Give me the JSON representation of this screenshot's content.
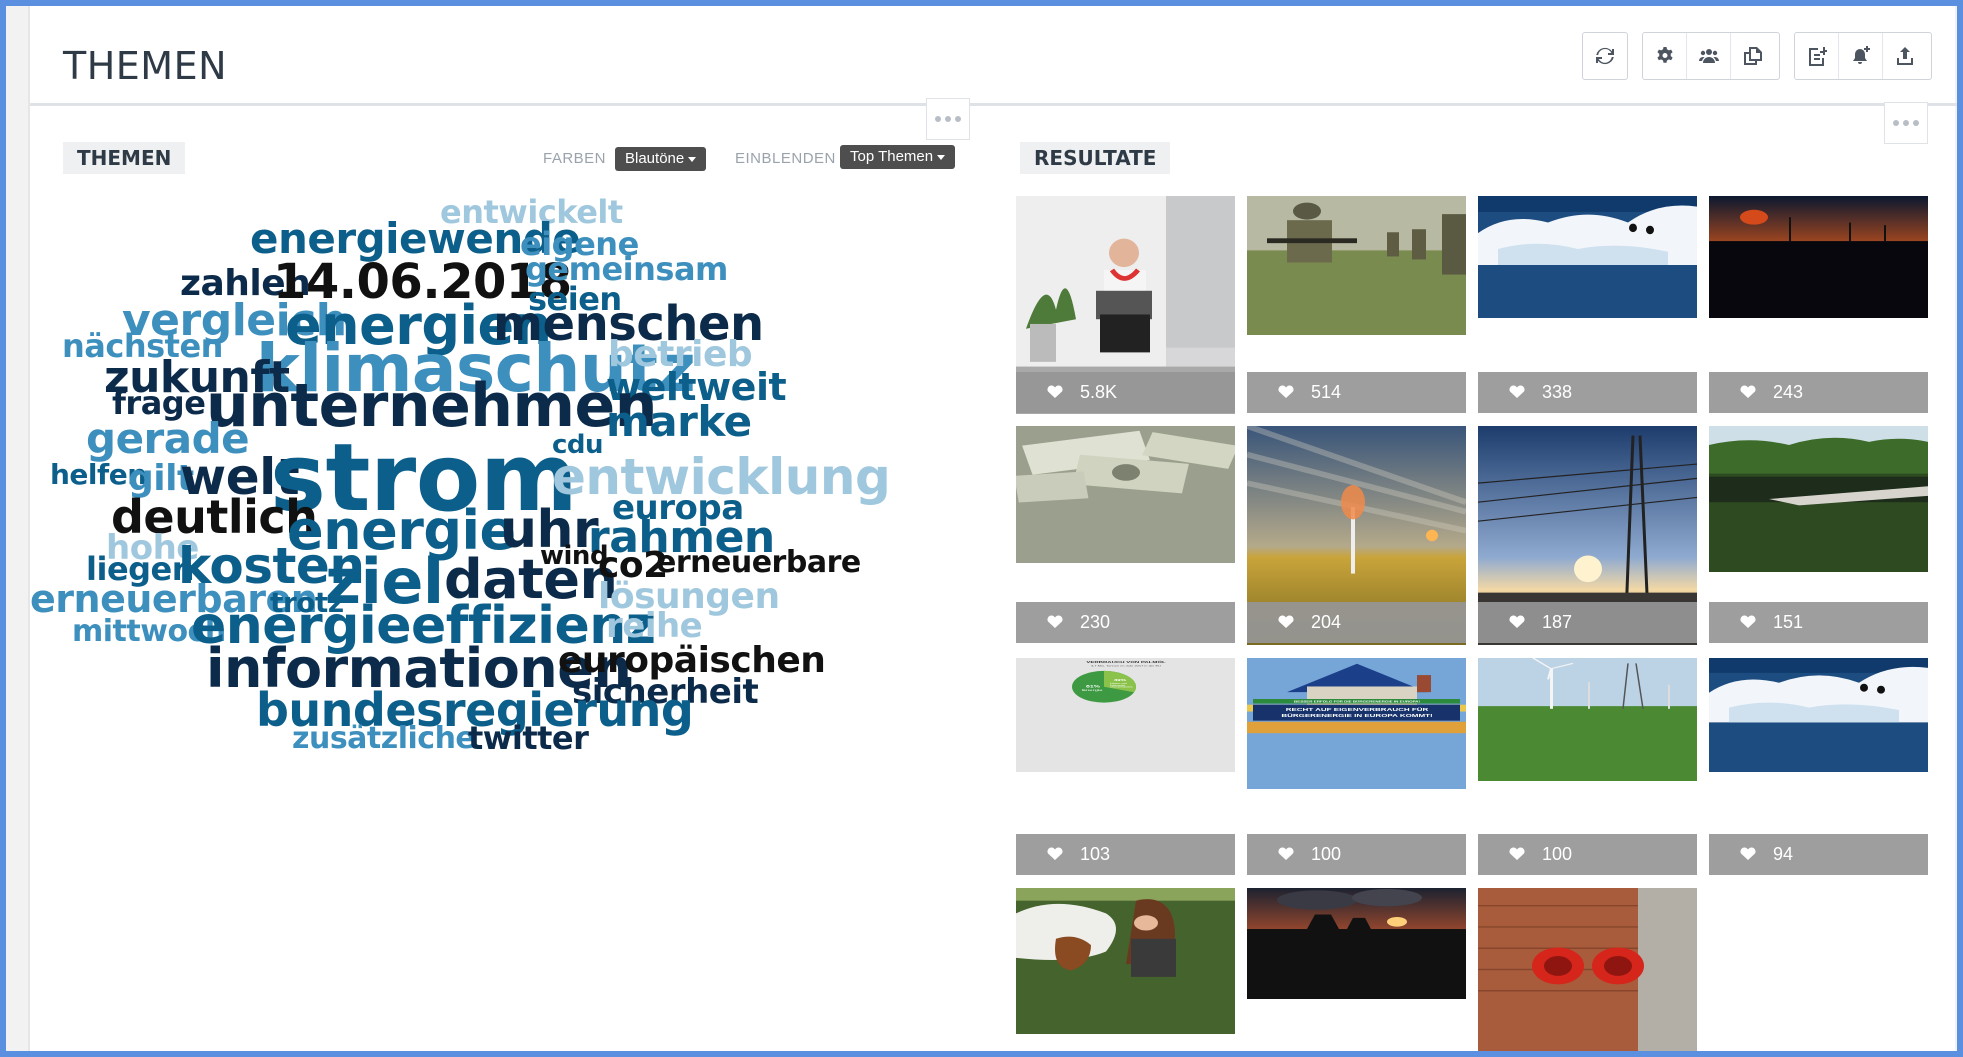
{
  "header": {
    "title": "THEMEN",
    "toolbar": [
      {
        "icon": "refresh-icon"
      },
      {
        "icon": "gear-icon"
      },
      {
        "icon": "users-icon"
      },
      {
        "icon": "copy-icon"
      },
      {
        "icon": "add-document-icon"
      },
      {
        "icon": "bell-add-icon"
      },
      {
        "icon": "upload-icon"
      }
    ]
  },
  "topics": {
    "label": "THEMEN",
    "colors_label": "FARBEN",
    "colors_value": "Blautöne",
    "show_label": "EINBLENDEN",
    "show_value": "Top Themen",
    "palette": {
      "dark": "#0c2b4a",
      "mid": "#0b5f8a",
      "light": "#3d8fbe",
      "pale": "#9fc7dd",
      "black": "#111111"
    },
    "words": [
      {
        "text": "entwickelt"
      },
      {
        "text": "energiewende"
      },
      {
        "text": "eigene"
      },
      {
        "text": "zahlen"
      },
      {
        "text": "14.06.2018"
      },
      {
        "text": "gemeinsam"
      },
      {
        "text": "seien"
      },
      {
        "text": "vergleich"
      },
      {
        "text": "energien"
      },
      {
        "text": "menschen"
      },
      {
        "text": "nächsten"
      },
      {
        "text": "klimaschutz"
      },
      {
        "text": "betrieb"
      },
      {
        "text": "zukunft"
      },
      {
        "text": "weltweit"
      },
      {
        "text": "frage"
      },
      {
        "text": "unternehmen"
      },
      {
        "text": "marke"
      },
      {
        "text": "gerade"
      },
      {
        "text": "cdu"
      },
      {
        "text": "helfen"
      },
      {
        "text": "gilt"
      },
      {
        "text": "welt"
      },
      {
        "text": "strom"
      },
      {
        "text": "entwicklung"
      },
      {
        "text": "europa"
      },
      {
        "text": "deutlich"
      },
      {
        "text": "energie"
      },
      {
        "text": "uhr"
      },
      {
        "text": "rahmen"
      },
      {
        "text": "hohe"
      },
      {
        "text": "wind"
      },
      {
        "text": "liegen"
      },
      {
        "text": "kosten"
      },
      {
        "text": "ziel"
      },
      {
        "text": "daten"
      },
      {
        "text": "co2"
      },
      {
        "text": "erneuerbare"
      },
      {
        "text": "erneuerbaren"
      },
      {
        "text": "trotz"
      },
      {
        "text": "lösungen"
      },
      {
        "text": "mittwoch"
      },
      {
        "text": "energieeffizienz"
      },
      {
        "text": "reihe"
      },
      {
        "text": "informationen"
      },
      {
        "text": "europäischen"
      },
      {
        "text": "sicherheit"
      },
      {
        "text": "bundesregierung"
      },
      {
        "text": "zusätzliche"
      },
      {
        "text": "twitter"
      }
    ]
  },
  "results": {
    "label": "RESULTATE",
    "items": [
      {
        "count": "5.8K",
        "image": "man-laptop-photo"
      },
      {
        "count": "514",
        "image": "soldiers-photo"
      },
      {
        "count": "338",
        "image": "ice-penguins-photo"
      },
      {
        "count": "243",
        "image": "wind-turbines-sunset-photo"
      },
      {
        "count": "230",
        "image": "dollar-bills-photo"
      },
      {
        "count": "204",
        "image": "spinning-turbine-field-photo"
      },
      {
        "count": "187",
        "image": "power-lines-photo"
      },
      {
        "count": "151",
        "image": "river-forest-photo"
      },
      {
        "count": "103",
        "image": "palm-oil-chart",
        "chart_title": "VERBRAUCH VON PALMÖL",
        "chart_subtitle": "3,7 Mio. Tonnen im Jahr 2017 in der EU",
        "slice_main": "61%",
        "slice_main_label": "Energie",
        "slice_other": "39%",
        "slice_other_label": "Lebens- und Futtermittel, Chemie/Industrie"
      },
      {
        "count": "100",
        "image": "solar-house-banner",
        "banner_top": "BESSER ERFOLG FÜR DIE BÜRGERENERGIE IN EUROPA!",
        "banner_text": "RECHT AUF EIGENVERBRAUCH FÜR BÜRGERENERGIE IN EUROPA KOMMT!"
      },
      {
        "count": "100",
        "image": "wind-turbines-field-photo"
      },
      {
        "count": "94",
        "image": "ice-penguins-photo"
      },
      {
        "image": "horse-woman-photo"
      },
      {
        "image": "power-plant-sunset-photo"
      },
      {
        "image": "brick-wall-sockets-photo"
      }
    ]
  }
}
